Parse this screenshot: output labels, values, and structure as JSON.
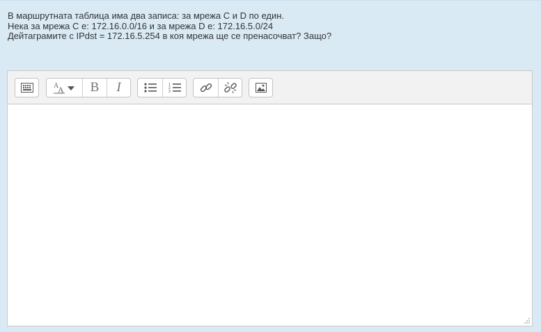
{
  "question": {
    "lines": [
      "В маршрутната таблица има два записа: за мрежа C и D по един.",
      "Нека за мрежа C е: 172.16.0.0/16 и за мрежа D е: 172.16.5.0/24",
      "Дейтаграмите с IPdst = 172.16.5.254 в коя мрежа ще се пренасочват? Защо?"
    ]
  },
  "toolbar": {
    "bold_label": "B",
    "italic_label": "I",
    "buttons": [
      {
        "icon": "keyboard-toggle-icon"
      },
      {
        "icon": "font-style-dropdown-icon"
      },
      {
        "icon": "bold-icon"
      },
      {
        "icon": "italic-icon"
      },
      {
        "icon": "bulleted-list-icon"
      },
      {
        "icon": "numbered-list-icon"
      },
      {
        "icon": "link-icon"
      },
      {
        "icon": "unlink-icon"
      },
      {
        "icon": "image-icon"
      }
    ]
  },
  "editor": {
    "content": ""
  },
  "colors": {
    "page_background": "#d9eaf5",
    "toolbar_background": "#f2f2f2",
    "editor_border": "#c7c7c7"
  }
}
